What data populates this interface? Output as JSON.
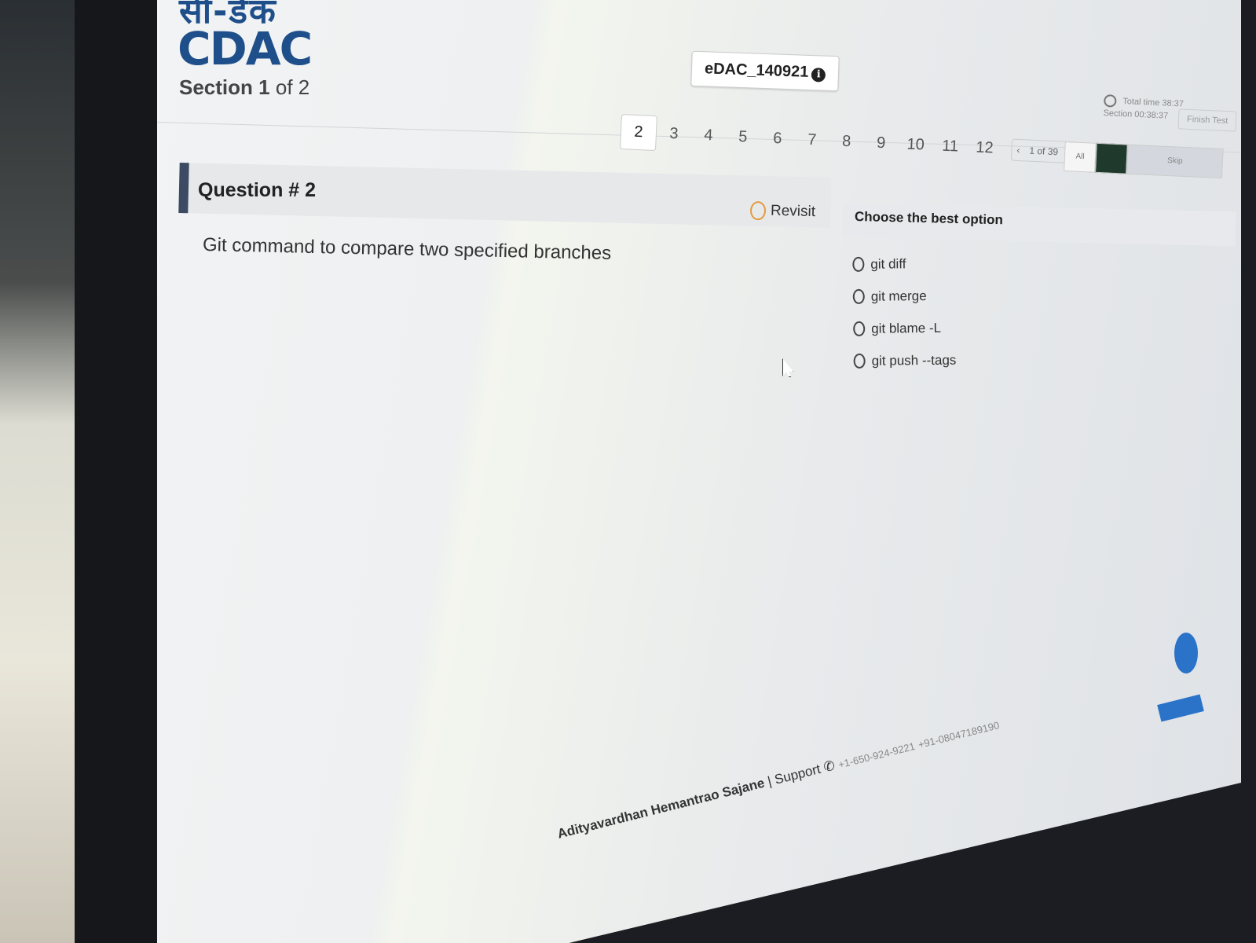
{
  "header": {
    "logo_hindi": "सी-डैक",
    "logo": "CDAC",
    "section_word": "Section",
    "section_current": "1",
    "section_of": "of 2",
    "test_id": "eDAC_140921"
  },
  "question_nav": {
    "numbers": [
      "2",
      "3",
      "4",
      "5",
      "6",
      "7",
      "8",
      "9",
      "10",
      "11",
      "12"
    ],
    "active": "2",
    "pager_prev": "‹",
    "pager_label": "1 of 39",
    "pager_next": "›"
  },
  "timer": {
    "total": "Total time 38:37",
    "section": "Section 00:38:37"
  },
  "finish_label": "Finish Test",
  "filters": [
    "All",
    "",
    "Skip"
  ],
  "question": {
    "title": "Question # 2",
    "revisit_label": "Revisit",
    "text": "Git command to compare two specified branches"
  },
  "options": {
    "title": "Choose the best option",
    "items": [
      "git diff",
      "git merge",
      "git blame -L",
      "git push --tags"
    ]
  },
  "footer": {
    "user_name": "Adityavardhan Hemantrao Sajane",
    "support_label": "| Support",
    "phone_us": "+1-650-924-9221",
    "phone_in": "+91-08047189190"
  },
  "colors": {
    "brand": "#1f4f8a",
    "question_bar": "#3c4a63",
    "accent_blue": "#2a73c9",
    "revisit_orange": "#e59a3d"
  }
}
